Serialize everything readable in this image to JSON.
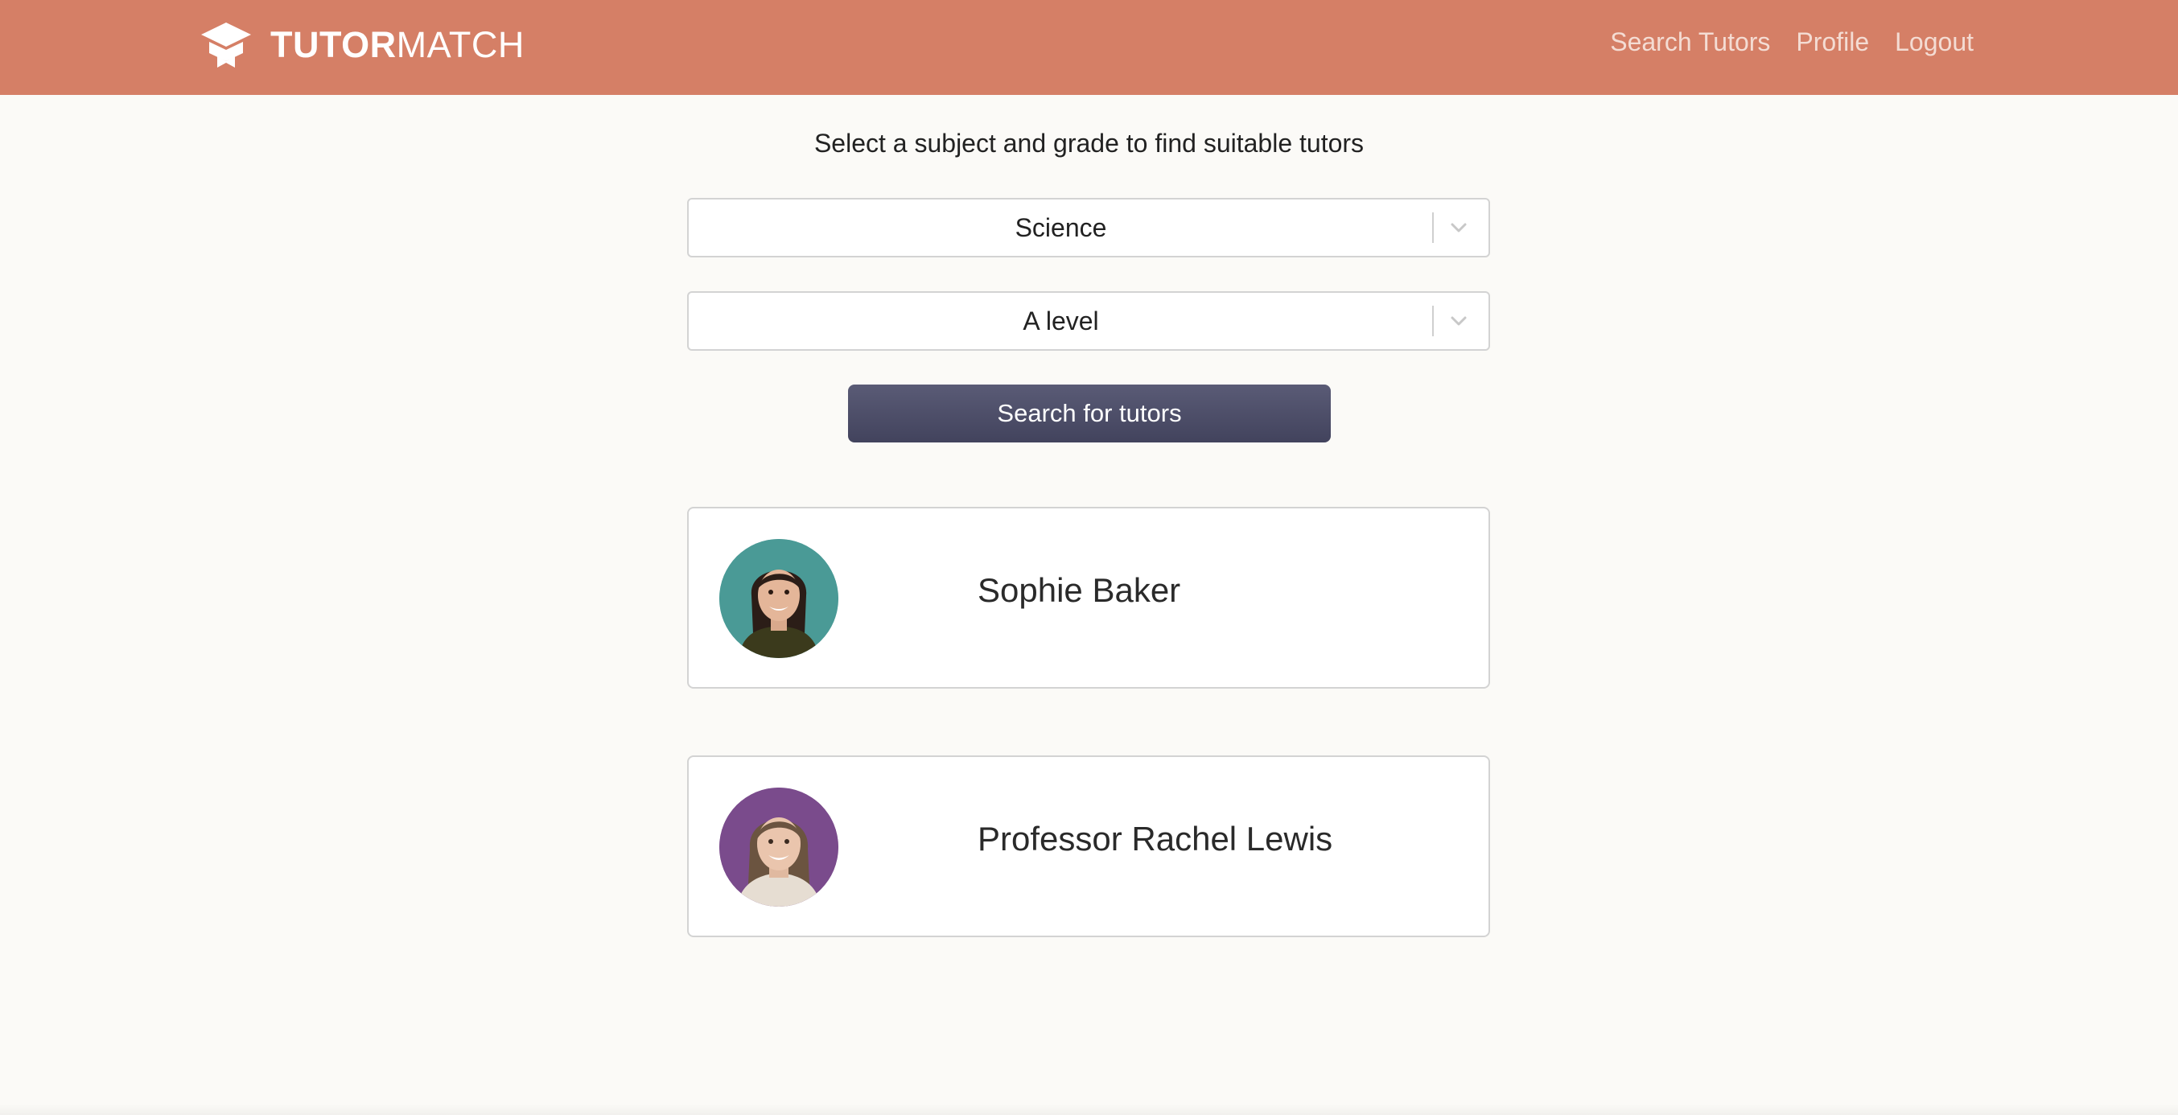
{
  "header": {
    "brand_bold": "TUTOR",
    "brand_light": "MATCH",
    "brand_icon": "graduation-cap-icon",
    "nav": [
      {
        "label": "Search Tutors"
      },
      {
        "label": "Profile"
      },
      {
        "label": "Logout"
      }
    ]
  },
  "search": {
    "prompt": "Select a subject and grade to find suitable tutors",
    "subject_value": "Science",
    "grade_value": "A level",
    "button_label": "Search for tutors"
  },
  "results": [
    {
      "name": "Sophie Baker",
      "avatar_bg": "#4a9a96"
    },
    {
      "name": "Professor Rachel Lewis",
      "avatar_bg": "#7a4b8c"
    }
  ],
  "colors": {
    "header_bg": "#d57f66",
    "page_bg": "#fbfaf7",
    "button_bg": "#4b4c66"
  }
}
